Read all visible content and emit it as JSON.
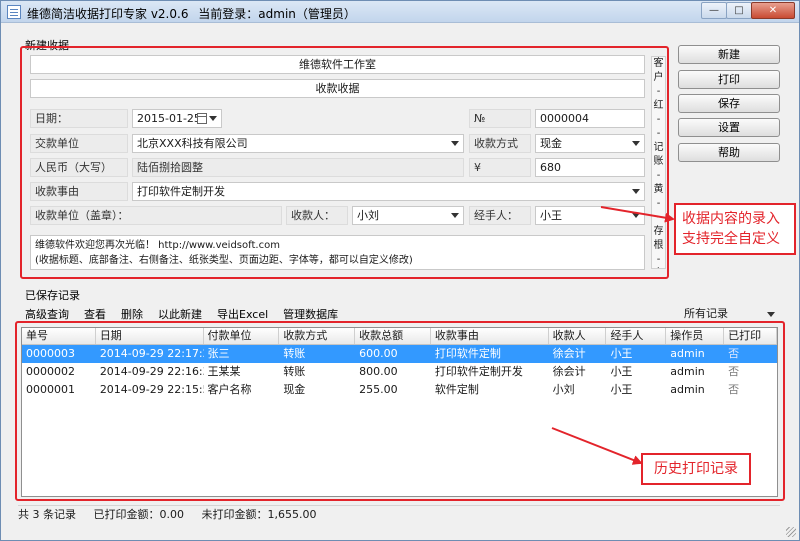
{
  "window": {
    "title": "维德简洁收据打印专家 v2.0.6",
    "login": "当前登录：admin（管理员）",
    "min": "—",
    "max": "□",
    "close": "✕"
  },
  "new_receipt": {
    "section_label": "新建收据",
    "company": "维德软件工作室",
    "doc_type": "收款收据",
    "date_label": "日期：",
    "date_value": "2015-01-25",
    "no_label": "№",
    "no_value": "0000004",
    "payer_label": "交款单位",
    "payer_value": "北京XXX科技有限公司",
    "pay_method_label": "收款方式",
    "pay_method_value": "现金",
    "rmb_label": "人民币（大写）",
    "rmb_value": "陆佰捌拾圆整",
    "yen": "¥",
    "amount": "680",
    "reason_label": "收款事由",
    "reason_value": "打印软件定制开发",
    "seal_label": "收款单位（盖章）：",
    "receiver_label": "收款人：",
    "receiver_value": "小刘",
    "handler_label": "经手人：",
    "handler_value": "小王",
    "notes_line1": "维德软件欢迎您再次光临！ http://www.veidsoft.com",
    "notes_line2": "(收据标题、底部备注、右侧备注、纸张类型、页面边距、字体等，都可以自定义修改)",
    "side_chars": [
      "客",
      "户",
      "-",
      "红",
      "-",
      "-",
      "记",
      "账",
      "-",
      "黄",
      "-",
      "-",
      "存",
      "根",
      "-",
      "白"
    ]
  },
  "buttons": {
    "new": "新建",
    "print": "打印",
    "save": "保存",
    "settings": "设置",
    "help": "帮助"
  },
  "annotations": {
    "top": [
      "收据内容的录入",
      "支持完全自定义"
    ],
    "bottom": "历史打印记录"
  },
  "saved": {
    "section_label": "已保存记录",
    "toolbar": [
      "高级查询",
      "查看",
      "删除",
      "以此新建",
      "导出Excel",
      "管理数据库"
    ],
    "filter": "所有记录",
    "columns": [
      "单号",
      "日期",
      "付款单位",
      "收款方式",
      "收款总额",
      "收款事由",
      "收款人",
      "经手人",
      "操作员",
      "已打印"
    ],
    "rows": [
      [
        "0000003",
        "2014-09-29 22:17:23",
        "张三",
        "转账",
        "600.00",
        "打印软件定制",
        "徐会计",
        "小王",
        "admin",
        "否"
      ],
      [
        "0000002",
        "2014-09-29 22:16:36",
        "王某某",
        "转账",
        "800.00",
        "打印软件定制开发",
        "徐会计",
        "小王",
        "admin",
        "否"
      ],
      [
        "0000001",
        "2014-09-29 22:15:59",
        "客户名称",
        "现金",
        "255.00",
        "软件定制",
        "小刘",
        "小王",
        "admin",
        "否"
      ]
    ]
  },
  "status": {
    "count": "共 3 条记录",
    "printed": "已打印金额：0.00",
    "unprinted": "未打印金额：1,655.00"
  },
  "colors": {
    "accent_red": "#e3242b",
    "selection_blue": "#3399ff"
  }
}
